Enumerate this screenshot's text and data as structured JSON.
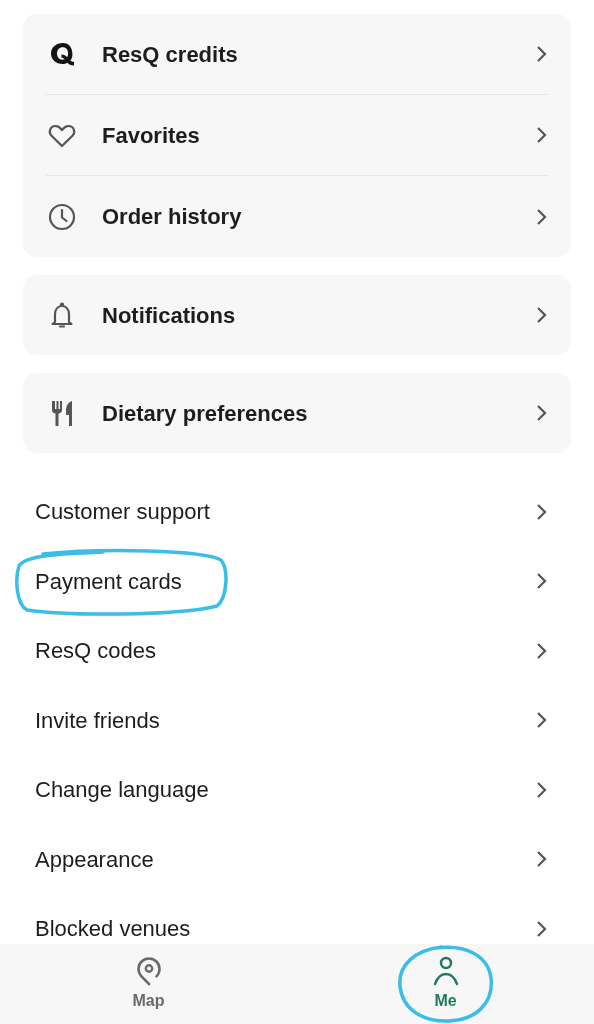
{
  "groups": [
    {
      "items": [
        {
          "kind": "credits",
          "label": "ResQ credits"
        },
        {
          "kind": "favorites",
          "label": "Favorites"
        },
        {
          "kind": "history",
          "label": "Order history"
        }
      ]
    },
    {
      "items": [
        {
          "kind": "notifications",
          "label": "Notifications"
        }
      ]
    },
    {
      "items": [
        {
          "kind": "dietary",
          "label": "Dietary preferences"
        }
      ]
    }
  ],
  "links": [
    {
      "label": "Customer support",
      "circled": false
    },
    {
      "label": "Payment cards",
      "circled": true
    },
    {
      "label": "ResQ codes",
      "circled": false
    },
    {
      "label": "Invite friends",
      "circled": false
    },
    {
      "label": "Change language",
      "circled": false
    },
    {
      "label": "Appearance",
      "circled": false
    },
    {
      "label": "Blocked venues",
      "circled": false
    }
  ],
  "nav": [
    {
      "kind": "map",
      "label": "Map",
      "selected": false,
      "circled": false
    },
    {
      "kind": "profile",
      "label": "Me",
      "selected": true,
      "circled": true
    }
  ]
}
